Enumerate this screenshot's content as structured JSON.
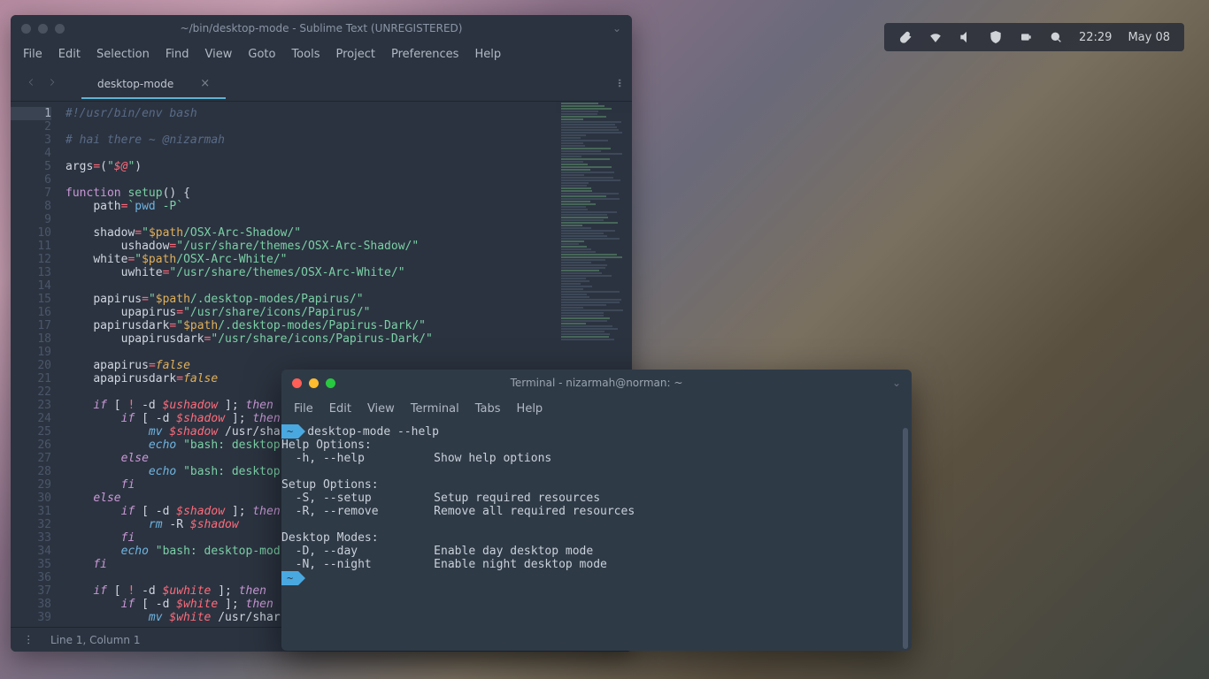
{
  "tray": {
    "icons": [
      "paperclip",
      "wifi",
      "volume",
      "shield",
      "battery",
      "search"
    ],
    "time": "22:29",
    "date": "May 08"
  },
  "sublime": {
    "title": "~/bin/desktop-mode - Sublime Text (UNREGISTERED)",
    "menu": [
      "File",
      "Edit",
      "Selection",
      "Find",
      "View",
      "Goto",
      "Tools",
      "Project",
      "Preferences",
      "Help"
    ],
    "tab": "desktop-mode",
    "status": "Line 1, Column 1",
    "code_lines": [
      {
        "n": 1,
        "t": "cm",
        "s": "#!/usr/bin/env bash"
      },
      {
        "n": 2,
        "t": "bl",
        "s": ""
      },
      {
        "n": 3,
        "t": "cm",
        "s": "# hai there ~ @nizarmah"
      },
      {
        "n": 4,
        "t": "bl",
        "s": ""
      },
      {
        "n": 5,
        "t": "args",
        "s": "args=(\"$@\")"
      },
      {
        "n": 6,
        "t": "bl",
        "s": ""
      },
      {
        "n": 7,
        "t": "func",
        "s": "function setup() {"
      },
      {
        "n": 8,
        "t": "assign_bt",
        "s": "    path=`pwd -P`"
      },
      {
        "n": 9,
        "t": "bl",
        "s": ""
      },
      {
        "n": 10,
        "t": "assign_sp",
        "var": "    shadow",
        "val": "/OSX-Arc-Shadow/"
      },
      {
        "n": 11,
        "t": "assign_s",
        "var": "        ushadow",
        "val": "/usr/share/themes/OSX-Arc-Shadow/"
      },
      {
        "n": 12,
        "t": "assign_sp",
        "var": "    white",
        "val": "/OSX-Arc-White/"
      },
      {
        "n": 13,
        "t": "assign_s",
        "var": "        uwhite",
        "val": "/usr/share/themes/OSX-Arc-White/"
      },
      {
        "n": 14,
        "t": "bl",
        "s": ""
      },
      {
        "n": 15,
        "t": "assign_sp",
        "var": "    papirus",
        "val": "/.desktop-modes/Papirus/"
      },
      {
        "n": 16,
        "t": "assign_s",
        "var": "        upapirus",
        "val": "/usr/share/icons/Papirus/"
      },
      {
        "n": 17,
        "t": "assign_sp",
        "var": "    papirusdark",
        "val": "/.desktop-modes/Papirus-Dark/"
      },
      {
        "n": 18,
        "t": "assign_s",
        "var": "        upapirusdark",
        "val": "/usr/share/icons/Papirus-Dark/"
      },
      {
        "n": 19,
        "t": "bl",
        "s": ""
      },
      {
        "n": 20,
        "t": "assign_b",
        "var": "    apapirus",
        "val": "false"
      },
      {
        "n": 21,
        "t": "assign_b",
        "var": "    apapirusdark",
        "val": "false"
      },
      {
        "n": 22,
        "t": "bl",
        "s": ""
      },
      {
        "n": 23,
        "t": "if_neg",
        "v": "ushadow"
      },
      {
        "n": 24,
        "t": "if_pos",
        "v": "shadow",
        "ind": "        "
      },
      {
        "n": 25,
        "t": "mv",
        "v": "shadow",
        "tail": " /usr/sha"
      },
      {
        "n": 26,
        "t": "echo",
        "s": "bash: desktop"
      },
      {
        "n": 27,
        "t": "else",
        "ind": "        "
      },
      {
        "n": 28,
        "t": "echo",
        "s": "bash: desktop"
      },
      {
        "n": 29,
        "t": "fi",
        "ind": "        "
      },
      {
        "n": 30,
        "t": "else",
        "ind": "    "
      },
      {
        "n": 31,
        "t": "if_pos",
        "v": "shadow",
        "ind": "        ",
        "then": true
      },
      {
        "n": 32,
        "t": "rm",
        "v": "shadow"
      },
      {
        "n": 33,
        "t": "fi",
        "ind": "        "
      },
      {
        "n": 34,
        "t": "echo2",
        "s": "bash: desktop-mod"
      },
      {
        "n": 35,
        "t": "fi",
        "ind": "    "
      },
      {
        "n": 36,
        "t": "bl",
        "s": ""
      },
      {
        "n": 37,
        "t": "if_neg",
        "v": "uwhite"
      },
      {
        "n": 38,
        "t": "if_pos",
        "v": "white",
        "ind": "        "
      },
      {
        "n": 39,
        "t": "mv",
        "v": "white",
        "tail": " /usr/shar"
      }
    ]
  },
  "terminal": {
    "title": "Terminal - nizarmah@norman: ~",
    "menu": [
      "File",
      "Edit",
      "View",
      "Terminal",
      "Tabs",
      "Help"
    ],
    "prompt": "~",
    "command": "desktop-mode --help",
    "output": "Help Options:\n  -h, --help          Show help options\n\nSetup Options:\n  -S, --setup         Setup required resources\n  -R, --remove        Remove all required resources\n\nDesktop Modes:\n  -D, --day           Enable day desktop mode\n  -N, --night         Enable night desktop mode"
  }
}
